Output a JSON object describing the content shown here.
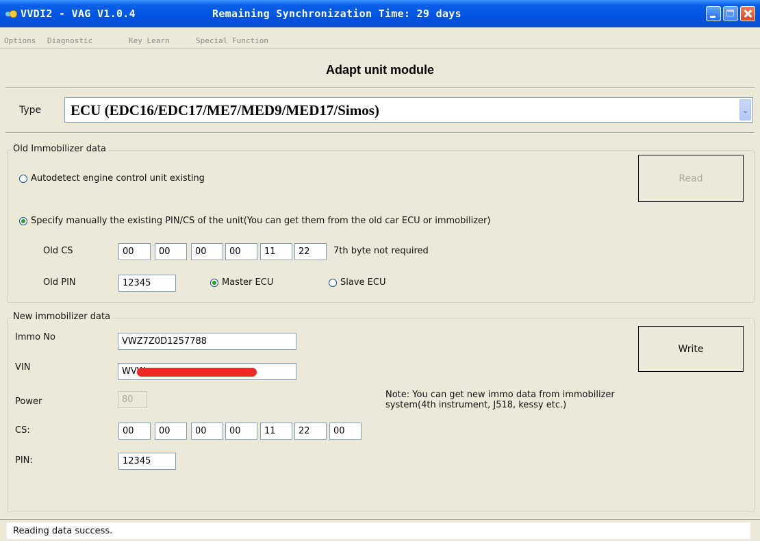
{
  "window": {
    "title_app": "VVDI2 - VAG V1.0.4",
    "title_sync": "Remaining Synchronization Time: 29 days"
  },
  "menu": [
    "Options",
    "Diagnostic",
    "Key Learn",
    "Special Function"
  ],
  "header": {
    "title": "Adapt unit module"
  },
  "type": {
    "label": "Type",
    "value": "ECU (EDC16/EDC17/ME7/MED9/MED17/Simos)",
    "arrow": "⌄"
  },
  "old_immo": {
    "group_label": "Old Immobilizer data",
    "autodetect_label": "Autodetect engine control unit existing",
    "autodetect_checked": false,
    "manual_label": "Specify manually the existing PIN/CS of the unit(You can get them from the old car ECU or immobilizer)",
    "manual_checked": true,
    "read_button": "Read",
    "cs_label": "Old CS",
    "cs_bytes": [
      "00",
      "00",
      "00",
      "00",
      "11",
      "22"
    ],
    "cs_note": "7th byte not required",
    "pin_label": "Old PIN",
    "pin_value": "12345",
    "master_label": "Master ECU",
    "master_checked": true,
    "slave_label": "Slave ECU",
    "slave_checked": false
  },
  "new_immo": {
    "group_label": "New immobilizer data",
    "immo_label": "Immo No",
    "immo_value": "VWZ7Z0D1257788",
    "vin_label": "VIN",
    "vin_value": "WVW",
    "power_label": "Power",
    "power_value": "80",
    "cs_label": "CS:",
    "cs_bytes": [
      "00",
      "00",
      "00",
      "00",
      "11",
      "22",
      "00"
    ],
    "pin_label": "PIN:",
    "pin_value": "12345",
    "write_button": "Write",
    "note": "Note: You can get new immo data from immobilizer system(4th instrument, J518, kessy etc.)"
  },
  "status": {
    "text": "Reading data success."
  }
}
